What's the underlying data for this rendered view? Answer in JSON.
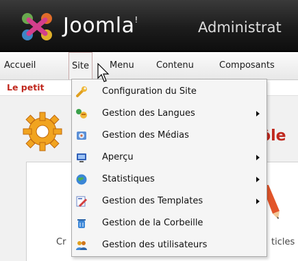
{
  "header": {
    "brand": "Joomla!",
    "brand_name": "Joomla",
    "brand_tm": "!",
    "admin_title": "Administrat"
  },
  "menubar": {
    "items": [
      {
        "label": "Accueil"
      },
      {
        "label": "Site"
      },
      {
        "label": "Menu"
      },
      {
        "label": "Contenu"
      },
      {
        "label": "Composants"
      }
    ]
  },
  "subbar": {
    "label": "Le petit"
  },
  "content": {
    "title": "ôle",
    "left_text": "Cr",
    "right_text": "ticles"
  },
  "dropdown": {
    "items": [
      {
        "label": "Configuration du Site",
        "icon": "wrench-icon",
        "has_submenu": false
      },
      {
        "label": "Gestion des Langues",
        "icon": "languages-icon",
        "has_submenu": true
      },
      {
        "label": "Gestion des Médias",
        "icon": "media-icon",
        "has_submenu": false
      },
      {
        "label": "Aperçu",
        "icon": "preview-icon",
        "has_submenu": true
      },
      {
        "label": "Statistiques",
        "icon": "globe-icon",
        "has_submenu": true
      },
      {
        "label": "Gestion des Templates",
        "icon": "templates-icon",
        "has_submenu": true
      },
      {
        "label": "Gestion de la Corbeille",
        "icon": "trash-icon",
        "has_submenu": false
      },
      {
        "label": "Gestion des utilisateurs",
        "icon": "users-icon",
        "has_submenu": false
      }
    ]
  },
  "colors": {
    "accent_red": "#c0281e",
    "header_dark": "#1c1c1c"
  }
}
